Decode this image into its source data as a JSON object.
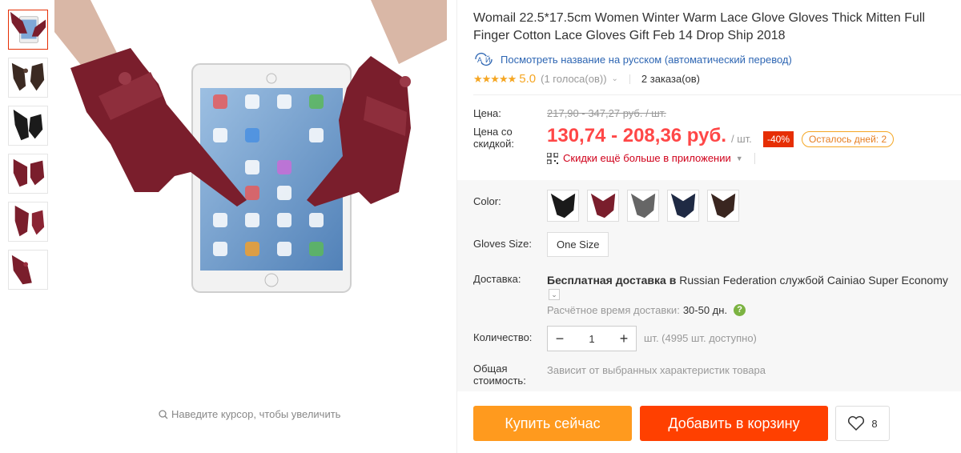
{
  "product": {
    "title": "Womail 22.5*17.5cm Women Winter Warm Lace Glove Gloves Thick Mitten Full Finger Cotton Lace Gloves Gift Feb 14 Drop Ship 2018",
    "translate_link": "Посмотреть название на русском (автоматический перевод)"
  },
  "gallery": {
    "thumbnails": [
      {
        "icon": "tablet-gloves-thumb"
      },
      {
        "icon": "brown-gloves-thumb"
      },
      {
        "icon": "black-gloves-thumb"
      },
      {
        "icon": "wine-gloves-thumb"
      },
      {
        "icon": "wine-gloves-thumb"
      },
      {
        "icon": "wine-gloves-thumb"
      }
    ],
    "zoom_hint": "Наведите курсор, чтобы увеличить"
  },
  "rating": {
    "stars": "★★★★★",
    "score": "5.0",
    "votes": "(1 голоса(ов))",
    "orders": "2 заказа(ов)"
  },
  "price": {
    "label_price": "Цена:",
    "label_discount_price": "Цена со скидкой:",
    "old_price": "217,90 - 347,27 руб. / шт.",
    "new_price": "130,74 - 208,36 руб.",
    "unit": "/ шт.",
    "discount": "-40%",
    "days_left": "Осталось дней: 2",
    "app_discount": "Скидки ещё больше в приложении"
  },
  "sku": {
    "color_label": "Color:",
    "colors": [
      "black",
      "wine",
      "gray",
      "navy",
      "brown"
    ],
    "size_label": "Gloves Size:",
    "size_value": "One Size",
    "shipping_label": "Доставка:",
    "shipping_free": "Бесплатная доставка в",
    "shipping_dest": "Russian Federation",
    "shipping_via": "службой",
    "shipping_carrier": "Cainiao Super Economy",
    "eta_label": "Расчётное время доставки:",
    "eta_value": "30-50 дн.",
    "help": "?",
    "qty_label": "Количество:",
    "qty_value": "1",
    "qty_info": "шт. (4995 шт. доступно)",
    "total_label": "Общая стоимость:",
    "total_info": "Зависит от выбранных характеристик товара"
  },
  "actions": {
    "buy_now": "Купить сейчас",
    "add_cart": "Добавить в корзину",
    "wish_count": "8"
  },
  "colors": {
    "accent_red": "#ff4747",
    "buy_now_orange": "#ff9a1e",
    "add_cart_red": "#ff4000",
    "star_orange": "#f5a623"
  }
}
